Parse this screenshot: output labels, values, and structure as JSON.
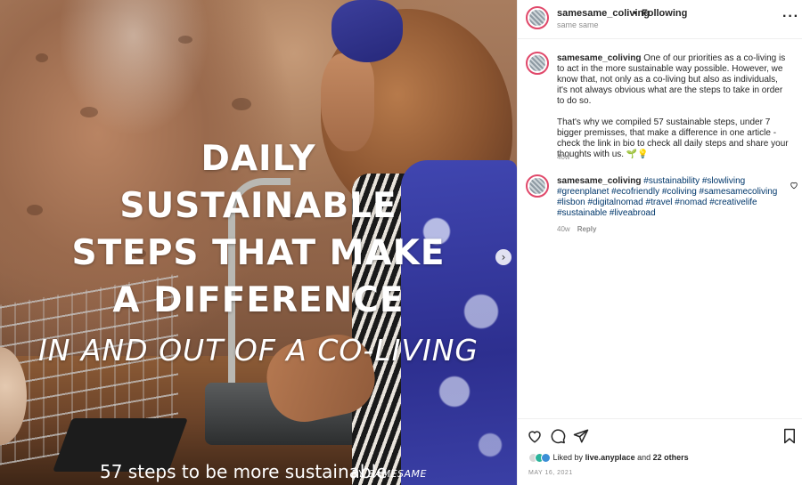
{
  "image": {
    "headline_lines": [
      "DAILY",
      "SUSTAINABLE",
      "STEPS THAT MAKE",
      "A DIFFERENCE"
    ],
    "subline": "IN AND OUT OF A CO-LIVING",
    "caption": "57 steps to be more sustainable",
    "brand": "BY SAMESAME",
    "next_icon": "chevron-right-icon"
  },
  "header": {
    "username": "samesame_coliving",
    "separator": "•",
    "follow_label": "Following",
    "location": "same same",
    "more_icon": "more-options-icon"
  },
  "post": {
    "username": "samesame_coliving",
    "paragraph1": "One of our priorities as a co-living is to act in the more sustainable way possible. However, we know that, not only as a co-living but also as individuals, it's not always obvious what are the steps to take in order to do so.",
    "paragraph2": "That's why we compiled 57 sustainable steps, under 7 bigger premisses, that make a difference in one article - check the link in bio to check all daily steps and share your thoughts with us. 🌱💡",
    "time": "40w"
  },
  "comment": {
    "username": "samesame_coliving",
    "hashtags": "#sustainability #slowliving #greenplanet #ecofriendly #coliving #samesamecoliving #lisbon #digitalnomad #travel #nomad #creativelife #sustainable #liveabroad",
    "time": "40w",
    "reply_label": "Reply"
  },
  "actions": {
    "icons": [
      "heart-icon",
      "comment-icon",
      "share-icon",
      "bookmark-icon"
    ],
    "liked_by_prefix": "Liked by",
    "liked_by_user": "live.anyplace",
    "liked_by_and": "and",
    "liked_by_others": "22 others",
    "date": "MAY 16, 2021"
  },
  "colors": {
    "username_text": "#262626",
    "hashtag_link": "#00376b",
    "muted": "#8e8e8e",
    "avatar_ring": "#e0486a"
  }
}
